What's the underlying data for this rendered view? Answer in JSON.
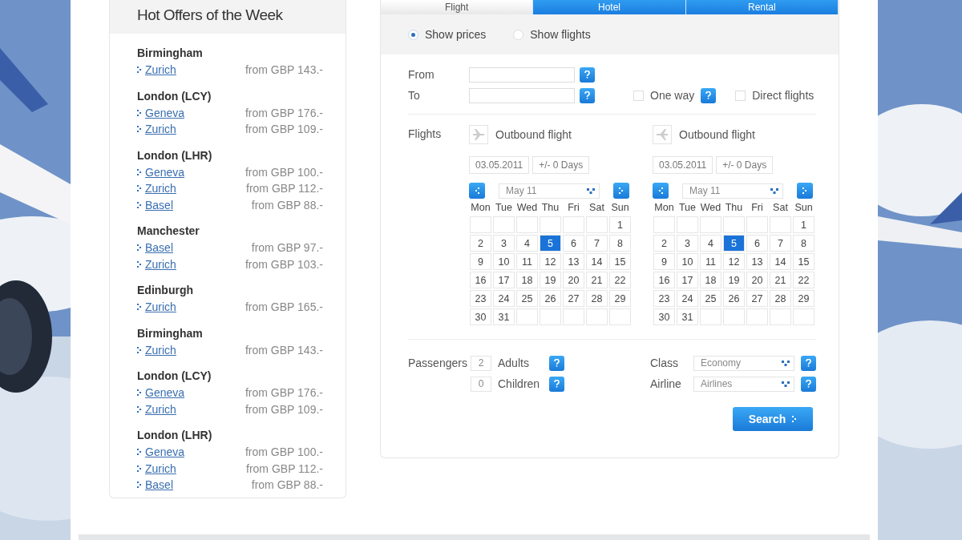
{
  "offers": {
    "title": "Hot Offers of the Week",
    "groups": [
      {
        "origin": "Birmingham",
        "routes": [
          {
            "city": "Zurich",
            "price": "from GBP 143.-"
          }
        ]
      },
      {
        "origin": "London (LCY)",
        "routes": [
          {
            "city": "Geneva",
            "price": "from GBP 176.-"
          },
          {
            "city": "Zurich",
            "price": "from GBP 109.-"
          }
        ]
      },
      {
        "origin": "London (LHR)",
        "routes": [
          {
            "city": "Geneva",
            "price": "from GBP 100.-"
          },
          {
            "city": "Zurich",
            "price": "from GBP 112.-"
          },
          {
            "city": "Basel",
            "price": "from GBP 88.-"
          }
        ]
      },
      {
        "origin": "Manchester",
        "routes": [
          {
            "city": "Basel",
            "price": "from GBP 97.-"
          },
          {
            "city": "Zurich",
            "price": "from GBP 103.-"
          }
        ]
      },
      {
        "origin": "Edinburgh",
        "routes": [
          {
            "city": "Zurich",
            "price": "from GBP 165.-"
          }
        ]
      },
      {
        "origin": "Birmingham",
        "routes": [
          {
            "city": "Zurich",
            "price": "from GBP 143.-"
          }
        ]
      },
      {
        "origin": "London (LCY)",
        "routes": [
          {
            "city": "Geneva",
            "price": "from GBP 176.-"
          },
          {
            "city": "Zurich",
            "price": "from GBP 109.-"
          }
        ]
      },
      {
        "origin": "London (LHR)",
        "routes": [
          {
            "city": "Geneva",
            "price": "from GBP 100.-"
          },
          {
            "city": "Zurich",
            "price": "from GBP 112.-"
          },
          {
            "city": "Basel",
            "price": "from GBP 88.-"
          }
        ]
      }
    ]
  },
  "tabs": [
    {
      "label": "Flight",
      "selected": true
    },
    {
      "label": "Hotel",
      "selected": false
    },
    {
      "label": "Rental",
      "selected": false
    }
  ],
  "display_options": [
    {
      "label": "Show prices",
      "selected": true
    },
    {
      "label": "Show flights",
      "selected": false
    }
  ],
  "route": {
    "from_label": "From",
    "to_label": "To",
    "one_way": {
      "label": "One way",
      "checked": false
    },
    "direct": {
      "label": "Direct flights",
      "checked": false
    }
  },
  "flights_label": "Flights",
  "calendars": [
    {
      "title": "Outbound flight",
      "date": "03.05.2011",
      "flex": "+/- 0 Days",
      "month": "May 11",
      "weekdays": [
        "Mon",
        "Tue",
        "Wed",
        "Thu",
        "Fri",
        "Sat",
        "Sun"
      ],
      "weeks": [
        [
          {
            "kind": "blank"
          },
          {
            "kind": "blank"
          },
          {
            "kind": "blank"
          },
          {
            "kind": "blank"
          },
          {
            "kind": "blank"
          },
          {
            "kind": "blank"
          },
          {
            "kind": "day",
            "day": "1",
            "selected": false
          }
        ],
        [
          {
            "kind": "day",
            "day": "2",
            "selected": false
          },
          {
            "kind": "day",
            "day": "3",
            "selected": false
          },
          {
            "kind": "day",
            "day": "4",
            "selected": false
          },
          {
            "kind": "day",
            "day": "5",
            "selected": true
          },
          {
            "kind": "day",
            "day": "6",
            "selected": false
          },
          {
            "kind": "day",
            "day": "7",
            "selected": false
          },
          {
            "kind": "day",
            "day": "8",
            "selected": false
          }
        ],
        [
          {
            "kind": "day",
            "day": "9",
            "selected": false
          },
          {
            "kind": "day",
            "day": "10",
            "selected": false
          },
          {
            "kind": "day",
            "day": "11",
            "selected": false
          },
          {
            "kind": "day",
            "day": "12",
            "selected": false
          },
          {
            "kind": "day",
            "day": "13",
            "selected": false
          },
          {
            "kind": "day",
            "day": "14",
            "selected": false
          },
          {
            "kind": "day",
            "day": "15",
            "selected": false
          }
        ],
        [
          {
            "kind": "day",
            "day": "16",
            "selected": false
          },
          {
            "kind": "day",
            "day": "17",
            "selected": false
          },
          {
            "kind": "day",
            "day": "18",
            "selected": false
          },
          {
            "kind": "day",
            "day": "19",
            "selected": false
          },
          {
            "kind": "day",
            "day": "20",
            "selected": false
          },
          {
            "kind": "day",
            "day": "21",
            "selected": false
          },
          {
            "kind": "day",
            "day": "22",
            "selected": false
          }
        ],
        [
          {
            "kind": "day",
            "day": "23",
            "selected": false
          },
          {
            "kind": "day",
            "day": "24",
            "selected": false
          },
          {
            "kind": "day",
            "day": "25",
            "selected": false
          },
          {
            "kind": "day",
            "day": "26",
            "selected": false
          },
          {
            "kind": "day",
            "day": "27",
            "selected": false
          },
          {
            "kind": "day",
            "day": "28",
            "selected": false
          },
          {
            "kind": "day",
            "day": "29",
            "selected": false
          }
        ],
        [
          {
            "kind": "day",
            "day": "30",
            "selected": false
          },
          {
            "kind": "day",
            "day": "31",
            "selected": false
          },
          {
            "kind": "blank"
          },
          {
            "kind": "blank"
          },
          {
            "kind": "blank"
          },
          {
            "kind": "blank"
          },
          {
            "kind": "blank"
          }
        ]
      ]
    },
    {
      "title": "Outbound flight",
      "date": "03.05.2011",
      "flex": "+/- 0 Days",
      "month": "May 11",
      "weekdays": [
        "Mon",
        "Tue",
        "Wed",
        "Thu",
        "Fri",
        "Sat",
        "Sun"
      ],
      "weeks": [
        [
          {
            "kind": "blank"
          },
          {
            "kind": "blank"
          },
          {
            "kind": "blank"
          },
          {
            "kind": "blank"
          },
          {
            "kind": "blank"
          },
          {
            "kind": "blank"
          },
          {
            "kind": "day",
            "day": "1",
            "selected": false
          }
        ],
        [
          {
            "kind": "day",
            "day": "2",
            "selected": false
          },
          {
            "kind": "day",
            "day": "3",
            "selected": false
          },
          {
            "kind": "day",
            "day": "4",
            "selected": false
          },
          {
            "kind": "day",
            "day": "5",
            "selected": true
          },
          {
            "kind": "day",
            "day": "6",
            "selected": false
          },
          {
            "kind": "day",
            "day": "7",
            "selected": false
          },
          {
            "kind": "day",
            "day": "8",
            "selected": false
          }
        ],
        [
          {
            "kind": "day",
            "day": "9",
            "selected": false
          },
          {
            "kind": "day",
            "day": "10",
            "selected": false
          },
          {
            "kind": "day",
            "day": "11",
            "selected": false
          },
          {
            "kind": "day",
            "day": "12",
            "selected": false
          },
          {
            "kind": "day",
            "day": "13",
            "selected": false
          },
          {
            "kind": "day",
            "day": "14",
            "selected": false
          },
          {
            "kind": "day",
            "day": "15",
            "selected": false
          }
        ],
        [
          {
            "kind": "day",
            "day": "16",
            "selected": false
          },
          {
            "kind": "day",
            "day": "17",
            "selected": false
          },
          {
            "kind": "day",
            "day": "18",
            "selected": false
          },
          {
            "kind": "day",
            "day": "19",
            "selected": false
          },
          {
            "kind": "day",
            "day": "20",
            "selected": false
          },
          {
            "kind": "day",
            "day": "21",
            "selected": false
          },
          {
            "kind": "day",
            "day": "22",
            "selected": false
          }
        ],
        [
          {
            "kind": "day",
            "day": "23",
            "selected": false
          },
          {
            "kind": "day",
            "day": "24",
            "selected": false
          },
          {
            "kind": "day",
            "day": "25",
            "selected": false
          },
          {
            "kind": "day",
            "day": "26",
            "selected": false
          },
          {
            "kind": "day",
            "day": "27",
            "selected": false
          },
          {
            "kind": "day",
            "day": "28",
            "selected": false
          },
          {
            "kind": "day",
            "day": "29",
            "selected": false
          }
        ],
        [
          {
            "kind": "day",
            "day": "30",
            "selected": false
          },
          {
            "kind": "day",
            "day": "31",
            "selected": false
          },
          {
            "kind": "blank"
          },
          {
            "kind": "blank"
          },
          {
            "kind": "blank"
          },
          {
            "kind": "blank"
          },
          {
            "kind": "blank"
          }
        ]
      ]
    }
  ],
  "passengers": {
    "label": "Passengers",
    "adults": {
      "value": "2",
      "label": "Adults"
    },
    "children": {
      "value": "0",
      "label": "Children"
    }
  },
  "class": {
    "label": "Class",
    "value": "Economy"
  },
  "airline": {
    "label": "Airline",
    "value": "Airlines"
  },
  "search_button": "Search"
}
